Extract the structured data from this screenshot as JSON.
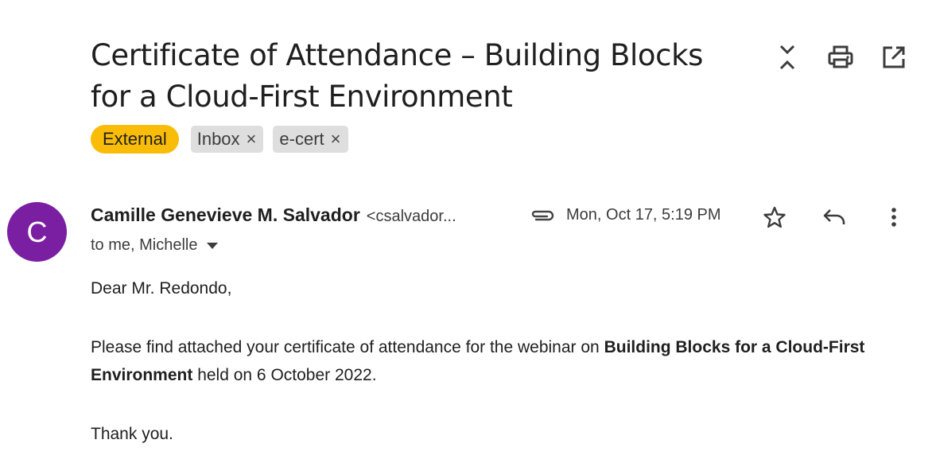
{
  "email": {
    "subject": "Certificate of Attendance – Building Blocks for a Cloud-First Environment",
    "labels": {
      "external": "External",
      "tags": [
        {
          "label": "Inbox",
          "remove": "×"
        },
        {
          "label": "e-cert",
          "remove": "×"
        }
      ]
    },
    "sender": {
      "initial": "C",
      "avatar_color": "#7b1fa2",
      "name": "Camille Genevieve M. Salvador",
      "email": "<csalvador..."
    },
    "date": "Mon, Oct 17, 5:19 PM",
    "recipients": "to me, Michelle",
    "body": {
      "greeting": "Dear Mr. Redondo,",
      "p1_start": "Please find attached your certificate of attendance for the webinar on ",
      "p1_bold": "Building Blocks for a Cloud-First Environment",
      "p1_end": " held on 6 October 2022.",
      "closing": "Thank you."
    }
  },
  "icons": {
    "toolbar": [
      "collapse-icon",
      "print-icon",
      "open-new-window-icon"
    ],
    "message": [
      "attachment-icon",
      "star-icon",
      "reply-icon",
      "more-vert-icon"
    ]
  },
  "colors": {
    "external_chip": "#f9bd09",
    "tag_chip": "#dedede"
  }
}
